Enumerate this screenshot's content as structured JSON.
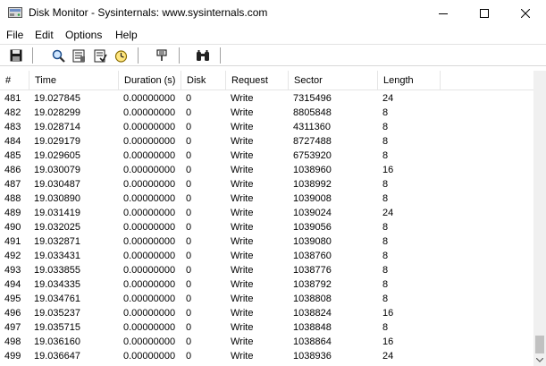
{
  "window": {
    "title": "Disk Monitor - Sysinternals: www.sysinternals.com",
    "minimize_glyph": "—",
    "maximize_glyph": "☐",
    "close_glyph": "✕"
  },
  "menu": {
    "items": [
      {
        "id": "file",
        "label": "File"
      },
      {
        "id": "edit",
        "label": "Edit"
      },
      {
        "id": "options",
        "label": "Options"
      },
      {
        "id": "help",
        "label": "Help"
      }
    ]
  },
  "toolbar": {
    "buttons": [
      {
        "id": "save",
        "icon": "floppy-disk-icon"
      },
      {
        "id": "find",
        "icon": "magnifier-icon"
      },
      {
        "id": "capture",
        "icon": "capture-icon"
      },
      {
        "id": "autoscroll",
        "icon": "autoscroll-icon"
      },
      {
        "id": "time",
        "icon": "clock-icon"
      },
      {
        "id": "filter",
        "icon": "filter-icon"
      },
      {
        "id": "search",
        "icon": "binoculars-icon"
      }
    ]
  },
  "table": {
    "columns": [
      "#",
      "Time",
      "Duration (s)",
      "Disk",
      "Request",
      "Sector",
      "Length"
    ],
    "rows": [
      [
        "481",
        "19.027845",
        "0.00000000",
        "0",
        "Write",
        "7315496",
        "24"
      ],
      [
        "482",
        "19.028299",
        "0.00000000",
        "0",
        "Write",
        "8805848",
        "8"
      ],
      [
        "483",
        "19.028714",
        "0.00000000",
        "0",
        "Write",
        "4311360",
        "8"
      ],
      [
        "484",
        "19.029179",
        "0.00000000",
        "0",
        "Write",
        "8727488",
        "8"
      ],
      [
        "485",
        "19.029605",
        "0.00000000",
        "0",
        "Write",
        "6753920",
        "8"
      ],
      [
        "486",
        "19.030079",
        "0.00000000",
        "0",
        "Write",
        "1038960",
        "16"
      ],
      [
        "487",
        "19.030487",
        "0.00000000",
        "0",
        "Write",
        "1038992",
        "8"
      ],
      [
        "488",
        "19.030890",
        "0.00000000",
        "0",
        "Write",
        "1039008",
        "8"
      ],
      [
        "489",
        "19.031419",
        "0.00000000",
        "0",
        "Write",
        "1039024",
        "24"
      ],
      [
        "490",
        "19.032025",
        "0.00000000",
        "0",
        "Write",
        "1039056",
        "8"
      ],
      [
        "491",
        "19.032871",
        "0.00000000",
        "0",
        "Write",
        "1039080",
        "8"
      ],
      [
        "492",
        "19.033431",
        "0.00000000",
        "0",
        "Write",
        "1038760",
        "8"
      ],
      [
        "493",
        "19.033855",
        "0.00000000",
        "0",
        "Write",
        "1038776",
        "8"
      ],
      [
        "494",
        "19.034335",
        "0.00000000",
        "0",
        "Write",
        "1038792",
        "8"
      ],
      [
        "495",
        "19.034761",
        "0.00000000",
        "0",
        "Write",
        "1038808",
        "8"
      ],
      [
        "496",
        "19.035237",
        "0.00000000",
        "0",
        "Write",
        "1038824",
        "16"
      ],
      [
        "497",
        "19.035715",
        "0.00000000",
        "0",
        "Write",
        "1038848",
        "8"
      ],
      [
        "498",
        "19.036160",
        "0.00000000",
        "0",
        "Write",
        "1038864",
        "16"
      ],
      [
        "499",
        "19.036647",
        "0.00000000",
        "0",
        "Write",
        "1038936",
        "24"
      ]
    ]
  }
}
